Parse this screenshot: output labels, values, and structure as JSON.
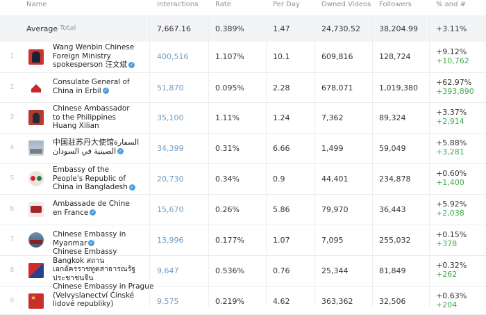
{
  "columns": {
    "name": "Name",
    "interactions": "Interactions",
    "rate": "Rate",
    "per_day": "Per Day",
    "owned_videos": "Owned Videos",
    "followers": "Followers",
    "change": "% and #"
  },
  "average": {
    "label": "Average",
    "sub": "Total",
    "interactions": "7,667.16",
    "rate": "0.389%",
    "per_day": "1.47",
    "owned_videos": "24,730.52",
    "followers": "38,204.99",
    "change_pct": "+3.11%"
  },
  "rows": [
    {
      "idx": "1",
      "name": "Wang Wenbin Chinese Foreign Ministry spokesperson 汪文斌",
      "interactions": "400,516",
      "rate": "1.107%",
      "per_day": "10.1",
      "owned_videos": "609,816",
      "followers": "128,724",
      "change_pct": "+9.12%",
      "change_num": "+10,762"
    },
    {
      "idx": "2",
      "name": "Consulate General of China in Erbil",
      "interactions": "51,870",
      "rate": "0.095%",
      "per_day": "2.28",
      "owned_videos": "678,071",
      "followers": "1,019,380",
      "change_pct": "+62.97%",
      "change_num": "+393,890"
    },
    {
      "idx": "3",
      "name": "Chinese Ambassador to the Philippines Huang Xilian",
      "interactions": "35,100",
      "rate": "1.11%",
      "per_day": "1.24",
      "owned_videos": "7,362",
      "followers": "89,324",
      "change_pct": "+3.37%",
      "change_num": "+2,914"
    },
    {
      "idx": "4",
      "name": "中国驻苏丹大使馆السفارة الصينية في السودان",
      "interactions": "34,399",
      "rate": "0.31%",
      "per_day": "6.66",
      "owned_videos": "1,499",
      "followers": "59,049",
      "change_pct": "+5.88%",
      "change_num": "+3,281"
    },
    {
      "idx": "5",
      "name": "Embassy of the People's Republic of China in Bangladesh",
      "interactions": "20,730",
      "rate": "0.34%",
      "per_day": "0.9",
      "owned_videos": "44,401",
      "followers": "234,878",
      "change_pct": "+0.60%",
      "change_num": "+1,400"
    },
    {
      "idx": "6",
      "name": "Ambassade de Chine en France",
      "interactions": "15,670",
      "rate": "0.26%",
      "per_day": "5.86",
      "owned_videos": "79,970",
      "followers": "36,443",
      "change_pct": "+5.92%",
      "change_num": "+2,038"
    },
    {
      "idx": "7",
      "name": "Chinese Embassy in Myanmar",
      "interactions": "13,996",
      "rate": "0.177%",
      "per_day": "1.07",
      "owned_videos": "7,095",
      "followers": "255,032",
      "change_pct": "+0.15%",
      "change_num": "+378"
    },
    {
      "idx": "8",
      "name": "Chinese Embassy Bangkok สถานเอกอัครราชทูตสาธารณรัฐประชาชนจีน",
      "interactions": "9,647",
      "rate": "0.536%",
      "per_day": "0.76",
      "owned_videos": "25,344",
      "followers": "81,849",
      "change_pct": "+0.32%",
      "change_num": "+262"
    },
    {
      "idx": "9",
      "name": "Chinese Embassy in Prague (Velvyslanectví Čínské lidové republiky)",
      "interactions": "9,575",
      "rate": "0.219%",
      "per_day": "4.62",
      "owned_videos": "363,362",
      "followers": "32,506",
      "change_pct": "+0.63%",
      "change_num": "+204"
    }
  ],
  "icons": {
    "verified": "verified-check-icon"
  },
  "colors": {
    "link": "#6e9cc4",
    "positive": "#3caa4a",
    "verified": "#4a9de0"
  }
}
